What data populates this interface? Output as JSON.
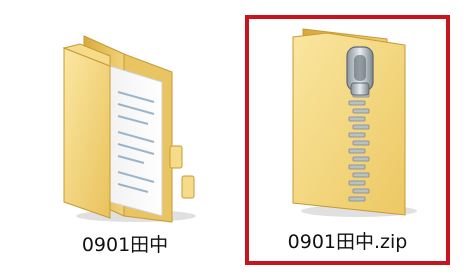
{
  "files": [
    {
      "name": "0901田中",
      "type": "folder",
      "icon": "folder-icon",
      "selected": false
    },
    {
      "name": "0901田中.zip",
      "type": "zip",
      "icon": "zip-folder-icon",
      "selected": true
    }
  ],
  "colors": {
    "selection_border": "#c8141c",
    "folder_yellow": "#f3d678",
    "folder_dark": "#d9ad3f",
    "background": "#ffffff"
  }
}
